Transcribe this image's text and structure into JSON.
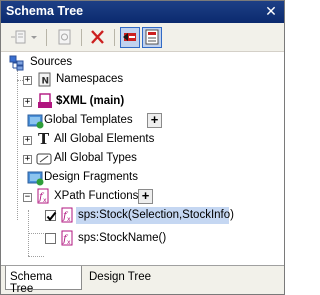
{
  "window": {
    "title": "Schema Tree",
    "close_glyph": "✕"
  },
  "toolbar": {
    "buttons": [
      {
        "name": "add-item-dropdown-button",
        "icon": "add-item-icon"
      },
      {
        "name": "insert-template-button",
        "icon": "template-icon"
      },
      {
        "name": "delete-button",
        "icon": "delete-x-icon"
      },
      {
        "name": "sort-ascending-toggle",
        "icon": "sort-icon"
      },
      {
        "name": "show-details-toggle",
        "icon": "details-icon"
      }
    ]
  },
  "tree": {
    "root": {
      "label": "Sources",
      "icon": "sources-icon"
    },
    "items": [
      {
        "label": "Namespaces",
        "icon": "namespace-icon",
        "expander": "+"
      },
      {
        "label": "$XML (main)",
        "icon": "xml-source-icon",
        "expander": "+",
        "bold": true
      },
      {
        "label": "Global Templates",
        "icon": "global-templates-icon",
        "add_glyph": "+"
      },
      {
        "label": "All Global Elements",
        "icon": "text-element-icon",
        "expander": "+"
      },
      {
        "label": "All Global Types",
        "icon": "global-types-icon",
        "expander": "+"
      },
      {
        "label": "Design Fragments",
        "icon": "design-fragments-icon"
      },
      {
        "label": "XPath Functions",
        "icon": "xpath-function-icon",
        "expander": "−",
        "add_glyph": "+"
      }
    ],
    "functions": [
      {
        "label": "sps:Stock(Selection,StockInfo)",
        "checked": true,
        "selected": true
      },
      {
        "label": "sps:StockName()",
        "checked": false,
        "selected": false
      }
    ]
  },
  "tabs": [
    {
      "label": "Schema Tree",
      "active": true
    },
    {
      "label": "Design Tree",
      "active": false
    }
  ],
  "colors": {
    "title_bar": "#0b2a6e",
    "selection": "#c5d7f2",
    "delete_red": "#cc2020",
    "xml_magenta": "#b0157f"
  }
}
